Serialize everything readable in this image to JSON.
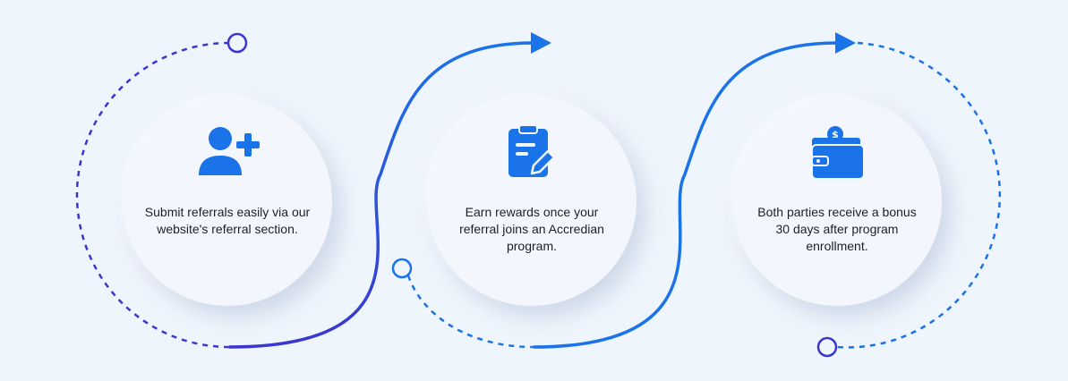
{
  "colors": {
    "background": "#eff5fd",
    "primary_blue": "#1a73e8",
    "indigo": "#3b36cf",
    "text": "#1b1f2a"
  },
  "steps": [
    {
      "icon": "add-user-icon",
      "text": "Submit referrals easily via our website's referral section."
    },
    {
      "icon": "clipboard-edit-icon",
      "text": "Earn rewards once your referral joins an Accredian program."
    },
    {
      "icon": "wallet-icon",
      "text": "Both parties receive a bonus 30 days after program enrollment."
    }
  ]
}
